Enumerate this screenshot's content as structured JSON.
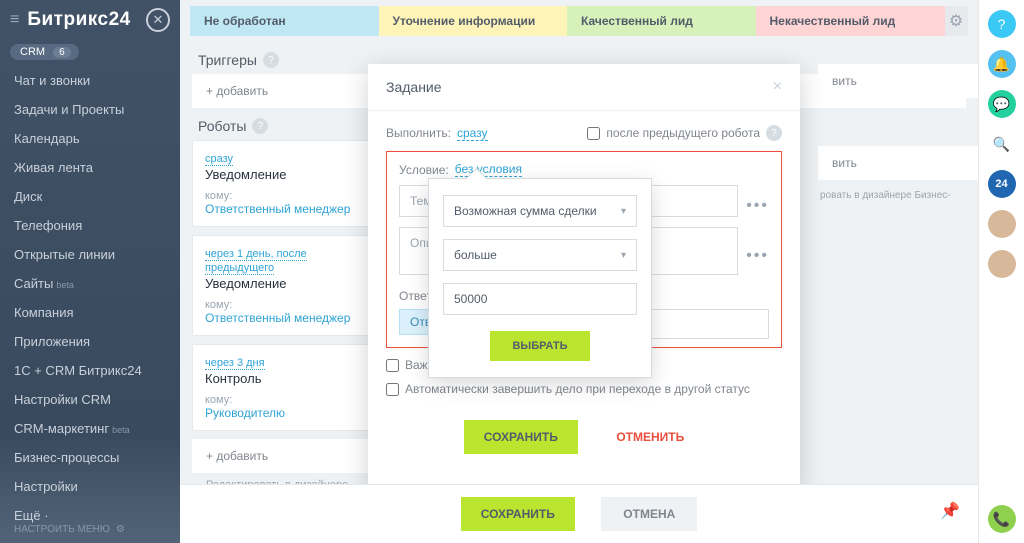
{
  "sidebar": {
    "logo": "Битрикс24",
    "crm_label": "CRM",
    "crm_badge": "6",
    "items": [
      {
        "label": "Чат и звонки"
      },
      {
        "label": "Задачи и Проекты"
      },
      {
        "label": "Календарь"
      },
      {
        "label": "Живая лента"
      },
      {
        "label": "Диск"
      },
      {
        "label": "Телефония"
      },
      {
        "label": "Открытые линии"
      },
      {
        "label": "Сайты",
        "beta": "beta"
      },
      {
        "label": "Компания"
      },
      {
        "label": "Приложения"
      },
      {
        "label": "1С + CRM Битрикс24"
      },
      {
        "label": "Настройки CRM"
      },
      {
        "label": "CRM-маркетинг",
        "beta": "beta"
      },
      {
        "label": "Бизнес-процессы"
      },
      {
        "label": "Настройки"
      },
      {
        "label": "Ещё ·"
      }
    ],
    "footer": "НАСТРОИТЬ МЕНЮ"
  },
  "stages": [
    {
      "label": "Не обработан"
    },
    {
      "label": "Уточнение информации"
    },
    {
      "label": "Качественный лид"
    },
    {
      "label": "Некачественный лид"
    }
  ],
  "sections": {
    "triggers": "Триггеры",
    "robots": "Роботы"
  },
  "add_link": "+ добавить",
  "edit_link": "Редактировать в дизайнере Бизнес-...",
  "right_stub": {
    "add": "вить",
    "edit": "ровать в дизайнере Бизнес-"
  },
  "robots": [
    {
      "time": "сразу",
      "title": "Уведомление",
      "who_label": "кому:",
      "who": "Ответственный менеджер"
    },
    {
      "time": "через 1 день, после предыдущего",
      "title": "Уведомление",
      "who_label": "кому:",
      "who": "Ответственный менеджер"
    },
    {
      "time": "через 3 дня",
      "title": "Контроль",
      "who_label": "кому:",
      "who": "Руководителю"
    }
  ],
  "modal": {
    "title": "Задание",
    "execute_label": "Выполнить:",
    "execute_value": "сразу",
    "after_prev": "после предыдущего робота",
    "condition_label": "Условие:",
    "condition_value": "без условия",
    "field_subject": "Тема",
    "field_desc": "Опис",
    "responsible_label": "Ответстве",
    "responsible_tag": "Ответс",
    "important": "Важное дело",
    "auto_complete": "Автоматически завершить дело при переходе в другой статус",
    "save": "СОХРАНИТЬ",
    "cancel": "ОТМЕНИТЬ"
  },
  "popover": {
    "field": "Возможная сумма сделки",
    "op": "больше",
    "value": "50000",
    "select": "ВЫБРАТЬ"
  },
  "bottom": {
    "save": "СОХРАНИТЬ",
    "cancel": "ОТМЕНА"
  }
}
